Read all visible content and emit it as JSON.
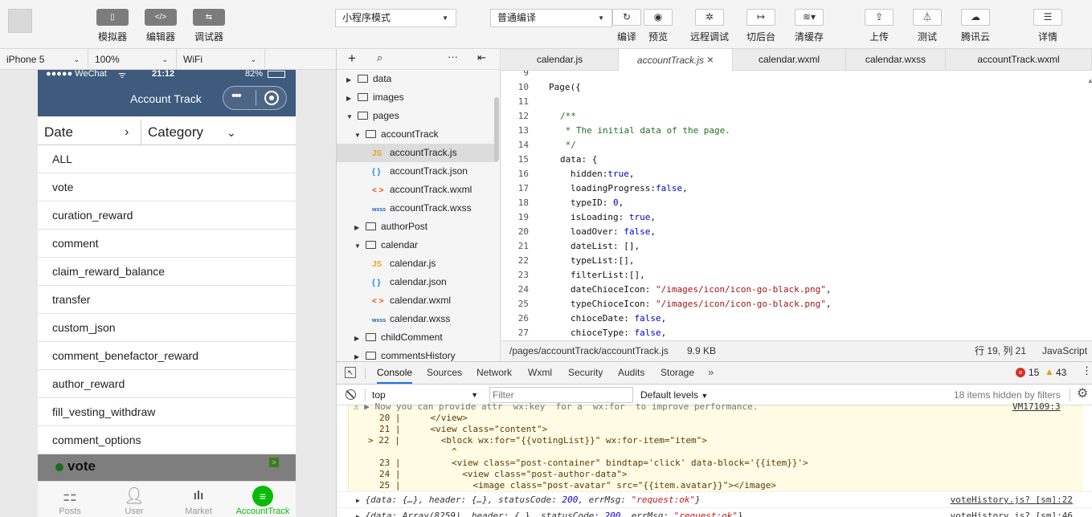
{
  "toolbar": {
    "simulator": "模拟器",
    "editor": "编辑器",
    "debugger": "调试器",
    "mode_select": "小程序模式",
    "compile_select": "普通编译",
    "compile": "编译",
    "preview": "预览",
    "remote_debug": "远程调试",
    "background": "切后台",
    "clear_cache": "清缓存",
    "upload": "上传",
    "test": "测试",
    "tencent_cloud": "腾讯云",
    "details": "详情"
  },
  "device_bar": {
    "device": "iPhone 5",
    "zoom": "100%",
    "network": "WiFi"
  },
  "phone": {
    "status": {
      "carrier": "●●●●● WeChat",
      "time": "21:12",
      "battery": "82%"
    },
    "title": "Account Track",
    "filters": {
      "date": "Date",
      "category": "Category"
    },
    "categories": [
      "ALL",
      "vote",
      "curation_reward",
      "comment",
      "claim_reward_balance",
      "transfer",
      "custom_json",
      "comment_benefactor_reward",
      "author_reward",
      "fill_vesting_withdraw",
      "comment_options"
    ],
    "overlay_text": "vote",
    "tabs": [
      "Posts",
      "User",
      "Market",
      "AccountTrack"
    ],
    "accent": "#09bb07"
  },
  "tree": {
    "rows": [
      "data",
      "images",
      "pages",
      "accountTrack",
      "accountTrack.js",
      "accountTrack.json",
      "accountTrack.wxml",
      "accountTrack.wxss",
      "authorPost",
      "calendar",
      "calendar.js",
      "calendar.json",
      "calendar.wxml",
      "calendar.wxss",
      "childComment",
      "commentsHistory"
    ],
    "file_badges": {
      "js": "JS",
      "json": "{ }",
      "wxml": "< >",
      "wxss": "wxss"
    }
  },
  "editor": {
    "tabs": [
      "calendar.js",
      "accountTrack.js",
      "calendar.wxml",
      "calendar.wxss",
      "accountTrack.wxml"
    ],
    "line_numbers": [
      "9",
      "10",
      "11",
      "12",
      "13",
      "14",
      "15",
      "16",
      "17",
      "18",
      "19",
      "20",
      "21",
      "22",
      "23",
      "24",
      "25",
      "26",
      "27"
    ],
    "code": {
      "l10": "Page({",
      "l12": "/**",
      "l13": " * The initial data of the page.",
      "l14": " */",
      "l15": "data: {",
      "l16a": "hidden:",
      "l16b": "true",
      "l17a": "loadingProgress:",
      "l17b": "false",
      "l18a": "typeID: ",
      "l18b": "0",
      "l19a": "isLoading: ",
      "l19b": "true",
      "l20a": "loadOver: ",
      "l20b": "false",
      "l21": "dateList: [],",
      "l22": "typeList:[],",
      "l23": "filterList:[],",
      "l24a": "dateChioceIcon: ",
      "l24b": "\"/images/icon/icon-go-black.png\"",
      "l25a": "typeChioceIcon: ",
      "l25b": "\"/images/icon/icon-go-black.png\"",
      "l26a": "chioceDate: ",
      "l26b": "false",
      "l27a": "chioceType: ",
      "l27b": "false"
    },
    "status": {
      "path": "/pages/accountTrack/accountTrack.js",
      "size": "9.9 KB",
      "position": "行 19, 列 21",
      "language": "JavaScript"
    }
  },
  "devtools": {
    "tabs": [
      "Console",
      "Sources",
      "Network",
      "Wxml",
      "Security",
      "Audits",
      "Storage"
    ],
    "errors": "15",
    "warnings": "43",
    "context": "top",
    "filter_placeholder": "Filter",
    "levels": "Default levels",
    "hidden": "18 items hidden by filters",
    "warn_top": "Now you can provide attr  wx:key  for a  wx:for  to improve performance.",
    "warn_src": "VM17109:3",
    "warn_lines": [
      {
        "n": "20",
        "t": "    </view>"
      },
      {
        "n": "21",
        "t": "    <view class=\"content\">"
      },
      {
        "n": "22",
        "t": "      <block wx:for=\"{{votingList}}\" wx:for-item=\"item\">"
      },
      {
        "n": "",
        "t": "        ^"
      },
      {
        "n": "23",
        "t": "        <view class=\"post-container\" bindtap='click' data-block='{{item}}'>"
      },
      {
        "n": "24",
        "t": "          <view class=\"post-author-data\">"
      },
      {
        "n": "25",
        "t": "            <image class=\"post-avatar\" src=\"{{item.avatar}}\"></image>"
      }
    ],
    "log1": {
      "a": "{data: {…}, header: {…}, statusCode: ",
      "code": "200",
      "b": ", errMsg: ",
      "msg": "\"request:ok\"",
      "c": "}",
      "src": "voteHistory.js? [sm]:22"
    },
    "log2": {
      "a": "{data: Array(8259), header: {…}, statusCode: ",
      "code": "200",
      "b": ", errMsg: ",
      "msg": "\"request:ok\"",
      "c": "}",
      "src": "voteHistory.js? [sm]:46"
    }
  }
}
